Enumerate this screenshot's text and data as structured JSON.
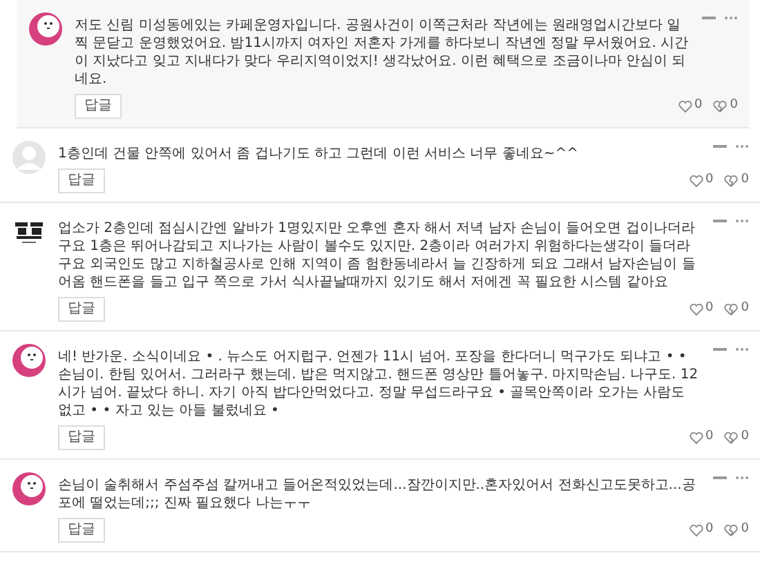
{
  "comments": [
    {
      "is_reply": true,
      "avatar": {
        "kind": "pink"
      },
      "text": "저도 신림 미성동에있는 카페운영자입니다. 공원사건이 이쪽근처라 작년에는 원래영업시간보다 일찍 문닫고 운영했었어요. 밤11시까지 여자인 저혼자 가게를 하다보니 작년엔 정말 무서웠어요. 시간이 지났다고 잊고 지내다가 맞다 우리지역이었지! 생각났어요. 이런 혜택으로 조금이나마 안심이 되네요.",
      "reply_label": "답글",
      "likes": "0",
      "dislikes": "0"
    },
    {
      "is_reply": false,
      "avatar": {
        "kind": "default"
      },
      "text": "1층인데 건물 안쪽에 있어서 좀 겁나기도 하고 그런데 이런 서비스 너무 좋네요~^^",
      "reply_label": "답글",
      "likes": "0",
      "dislikes": "0"
    },
    {
      "is_reply": false,
      "avatar": {
        "kind": "logo"
      },
      "text": "업소가 2층인데 점심시간엔 알바가 1명있지만 오후엔 혼자 해서 저녁 남자 손님이 들어오면 겁이나더라구요 1층은 뛰어나감되고 지나가는 사람이 볼수도 있지만. 2층이라 여러가지 위험하다는생각이 들더라구요 외국인도 많고 지하철공사로 인해 지역이 좀 험한동네라서 늘 긴장하게 되요 그래서 남자손님이 들어옴 핸드폰을 들고 입구 쪽으로 가서 식사끝날때까지 있기도 해서 저에겐 꼭 필요한 시스템 같아요",
      "reply_label": "답글",
      "likes": "0",
      "dislikes": "0"
    },
    {
      "is_reply": false,
      "avatar": {
        "kind": "pink"
      },
      "text": "네! 반가운. 소식이네요 • . 뉴스도 어지럽구. 언젠가 11시 넘어. 포장을 한다더니 먹구가도 되냐고 • • 손님이. 한팀 있어서. 그러라구 했는데. 밥은 먹지않고. 핸드폰 영상만 틀어놓구. 마지막손님. 나구도. 12시가 넘어. 끝났다 하니. 자기 아직 밥다안먹었다고. 정말 무섭드라구요 • 골목안쪽이라 오가는 사람도 없고 • • 자고 있는 아들 불렀네요 •",
      "reply_label": "답글",
      "likes": "0",
      "dislikes": "0"
    },
    {
      "is_reply": false,
      "avatar": {
        "kind": "pink"
      },
      "text": "손님이 술취해서 주섬주섬 칼꺼내고 들어온적있었는데...잠깐이지만..혼자있어서 전화신고도못하고...공포에 떨었는데;;; 진짜 필요했다 나는ㅜㅜ",
      "reply_label": "답글",
      "likes": "0",
      "dislikes": "0"
    }
  ]
}
